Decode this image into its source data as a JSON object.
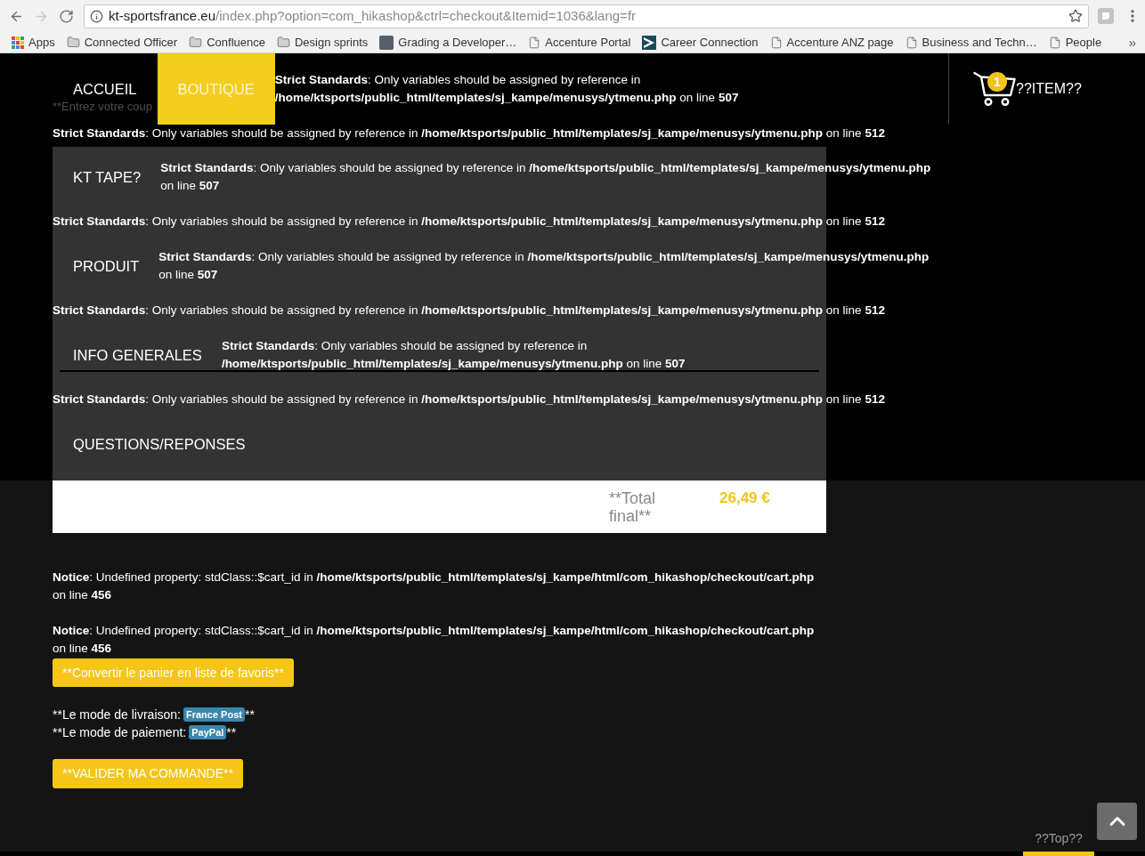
{
  "browser": {
    "nav": [
      {
        "kind": "back",
        "disabled": false
      },
      {
        "kind": "forward",
        "disabled": true
      },
      {
        "kind": "reload",
        "disabled": false
      }
    ],
    "url": {
      "host": "kt-sportsfrance.eu",
      "path": "/index.php?option=com_hikashop&ctrl=checkout&Itemid=1036&lang=fr"
    },
    "bookmarks": [
      {
        "kind": "apps",
        "label": "Apps"
      },
      {
        "kind": "folder",
        "label": "Connected Officer"
      },
      {
        "kind": "folder",
        "label": "Confluence"
      },
      {
        "kind": "folder",
        "label": "Design sprints"
      },
      {
        "kind": "photo",
        "label": "Grading a Developer…"
      },
      {
        "kind": "page",
        "label": "Accenture Portal"
      },
      {
        "kind": "logo",
        "label": "Career Connection"
      },
      {
        "kind": "page",
        "label": "Accenture ANZ page"
      },
      {
        "kind": "page",
        "label": "Business and Techn…"
      },
      {
        "kind": "page",
        "label": "People"
      }
    ],
    "overflow": "»"
  },
  "header": {
    "coupon_hint": "**Entrez votre coup",
    "nav": [
      {
        "label": "ACCUEIL",
        "selected": false
      },
      {
        "label": "BOUTIQUE",
        "selected": true
      }
    ],
    "error": "**Strict Standards**: Only variables should be assigned by reference in **/home/ktsports/public_html/templates/sj_kampe/menusys/ytmenu.php** on line **507**",
    "cart": {
      "count": "1",
      "label": "??ITEM??"
    }
  },
  "header_error": "**Strict Standards**: Only variables should be assigned by reference in **/home/ktsports/public_html/templates/sj_kampe/menusys/ytmenu.php** on line **512**",
  "menu_panel": {
    "rows": [
      {
        "kind": "item",
        "label": "KT TAPE?",
        "underlined": false,
        "error": "**Strict Standards**: Only variables should be assigned by reference in **/home/ktsports/public_html/templates/sj_kampe/menusys/ytmenu.php** on line **507**"
      },
      {
        "kind": "error",
        "text": "**Strict Standards**: Only variables should be assigned by reference in **/home/ktsports/public_html/templates/sj_kampe/menusys/ytmenu.php** on line **512**"
      },
      {
        "kind": "item",
        "label": "PRODUIT",
        "underlined": false,
        "error": "**Strict Standards**: Only variables should be assigned by reference in **/home/ktsports/public_html/templates/sj_kampe/menusys/ytmenu.php** on line **507**"
      },
      {
        "kind": "error",
        "text": "**Strict Standards**: Only variables should be assigned by reference in **/home/ktsports/public_html/templates/sj_kampe/menusys/ytmenu.php** on line **512**"
      },
      {
        "kind": "item",
        "label": "INFO GENERALES",
        "underlined": true,
        "error": "**Strict Standards**: Only variables should be assigned by reference in **/home/ktsports/public_html/templates/sj_kampe/menusys/ytmenu.php** on line **507**"
      },
      {
        "kind": "error",
        "text": "**Strict Standards**: Only variables should be assigned by reference in **/home/ktsports/public_html/templates/sj_kampe/menusys/ytmenu.php** on line **512**"
      },
      {
        "kind": "item",
        "label": "QUESTIONS/REPONSES",
        "underlined": false
      }
    ]
  },
  "total": {
    "label": "**Total final**",
    "amount": "26,49 €"
  },
  "notices": [
    "**Notice**: Undefined property: stdClass::$cart_id in **/home/ktsports/public_html/templates/sj_kampe/html/com_hikashop/checkout/cart.php** on line **456**",
    "**Notice**: Undefined property: stdClass::$cart_id in **/home/ktsports/public_html/templates/sj_kampe/html/com_hikashop/checkout/cart.php** on line **456**"
  ],
  "wishlist_button": "**Convertir le panier en liste de favoris**",
  "methods": [
    {
      "label": "**Le mode de livraison:",
      "value": "France Post",
      "suffix": "**"
    },
    {
      "label": "**Le mode de paiement:",
      "value": "PayPal",
      "suffix": "**"
    }
  ],
  "confirm_button": "**VALIDER MA COMMANDE**",
  "footer": {
    "top_link": "??Top??"
  }
}
